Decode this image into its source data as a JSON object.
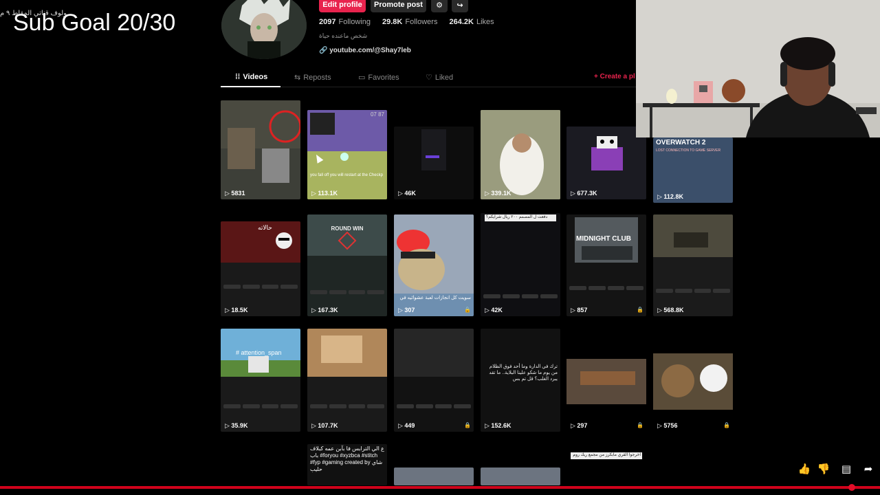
{
  "overlay": {
    "sub_goal": "Sub Goal 20/30",
    "channel_tag": "ولوف قناتي المقاط ٩ م"
  },
  "profile": {
    "edit_label": "Edit profile",
    "promote_label": "Promote post",
    "following_count": "2097",
    "following_label": "Following",
    "followers_count": "29.8K",
    "followers_label": "Followers",
    "likes_count": "264.2K",
    "likes_label": "Likes",
    "bio": "شخص ماعنده حياة",
    "link": "youtube.com/@Shay7leb",
    "icons": {
      "link": "link-icon",
      "settings": "gear-icon",
      "share": "share-icon"
    }
  },
  "tabs": [
    {
      "label": "Videos",
      "icon": "grid-icon"
    },
    {
      "label": "Reposts",
      "icon": "repost-icon"
    },
    {
      "label": "Favorites",
      "icon": "bookmark-icon"
    },
    {
      "label": "Liked",
      "icon": "heart-icon"
    }
  ],
  "create_label": "+ Create a pl",
  "videos": [
    {
      "views": "5831"
    },
    {
      "views": "113.1K",
      "overlay_text": "you fall off you will restart at the Checkp",
      "time_text": "07 87"
    },
    {
      "views": "46K"
    },
    {
      "views": "339.1K"
    },
    {
      "views": "677.3K"
    },
    {
      "views": "112.8K",
      "overlay_text": "OVERWATCH 2",
      "sub_text": "LOST CONNECTION TO GAME SERVER"
    },
    {
      "views": "18.5K",
      "overlay_text": "حالاته"
    },
    {
      "views": "167.3K",
      "overlay_text": "ROUND WIN"
    },
    {
      "views": "307",
      "overlay_text": "سويت كل انجازات لعبة عشوائيه في",
      "locked": true
    },
    {
      "views": "42K",
      "overlay_text": "دفعت ل المصمم ٢٠٠ ريال شرايكم؟"
    },
    {
      "views": "857",
      "overlay_text": "MIDNIGHT CLUB",
      "locked": true
    },
    {
      "views": "568.8K"
    },
    {
      "views": "35.9K",
      "overlay_text": "# attention_span"
    },
    {
      "views": "107.7K"
    },
    {
      "views": "449",
      "locked": true
    },
    {
      "views": "152.6K",
      "overlay_text": "ترك في الدارة وما أحد فوق الظلام من يوم ما شكو علينا البلاية.. ما تقد يبرد الغلب؟ قل تم بس"
    },
    {
      "views": "297",
      "locked": true
    },
    {
      "views": "5756",
      "locked": true
    },
    {
      "overlay_text": "ع الي الترابس فا بآبن عمه كبلاف باب #foryou #xyzbca #stitch #fyp #gaming created by شاي حليب"
    },
    {
      "overlay_text": "اخرجوا القري مابكرز من مجمع ريك روم"
    }
  ],
  "colors": {
    "accent": "#e8234d",
    "progress": "#d0021b",
    "background": "#000000"
  }
}
